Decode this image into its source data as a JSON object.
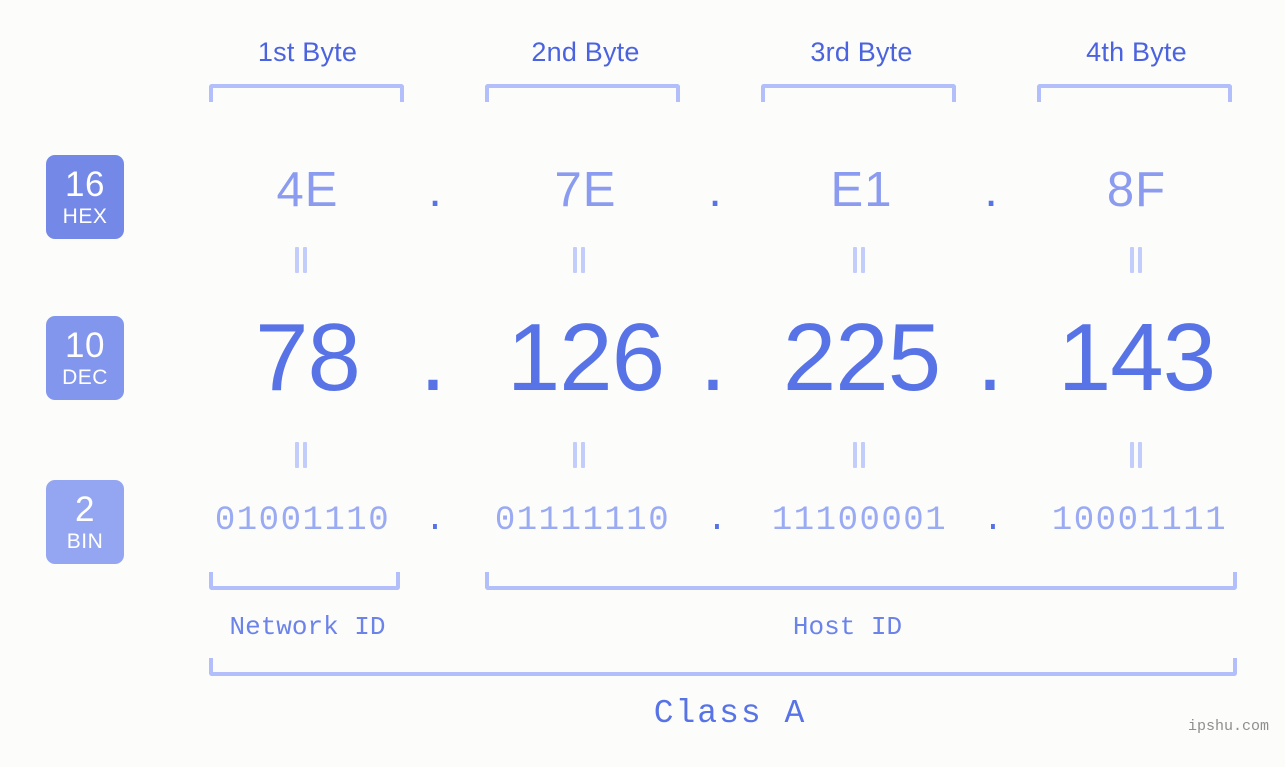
{
  "meta": {
    "watermark": "ipshu.com",
    "bg_color": "#fcfdfa",
    "accent_strong": "#5873e6",
    "accent_mid": "#8b9bef",
    "accent_light": "#b3bffa"
  },
  "headers": {
    "bytes": [
      {
        "label": "1st Byte"
      },
      {
        "label": "2nd Byte"
      },
      {
        "label": "3rd Byte"
      },
      {
        "label": "4th Byte"
      }
    ]
  },
  "bases": [
    {
      "num": "16",
      "unit": "HEX",
      "color": "#7488e8"
    },
    {
      "num": "10",
      "unit": "DEC",
      "color": "#8396ee"
    },
    {
      "num": "2",
      "unit": "BIN",
      "color": "#94a6f2"
    }
  ],
  "rows": {
    "hex": {
      "base_label": "HEX",
      "values": [
        "4E",
        "7E",
        "E1",
        "8F"
      ],
      "separator": "."
    },
    "dec": {
      "base_label": "DEC",
      "values": [
        "78",
        "126",
        "225",
        "143"
      ],
      "separator": "."
    },
    "bin": {
      "base_label": "BIN",
      "values": [
        "01001110",
        "01111110",
        "11100001",
        "10001111"
      ],
      "separator": "."
    }
  },
  "equals_symbol": "=",
  "sections": {
    "network_id": "Network ID",
    "host_id": "Host ID",
    "class": "Class A"
  },
  "address": {
    "dotted_decimal": "78.126.225.143",
    "dotted_hex": "4E.7E.E1.8F",
    "dotted_binary": "01001110.01111110.11100001.10001111"
  }
}
